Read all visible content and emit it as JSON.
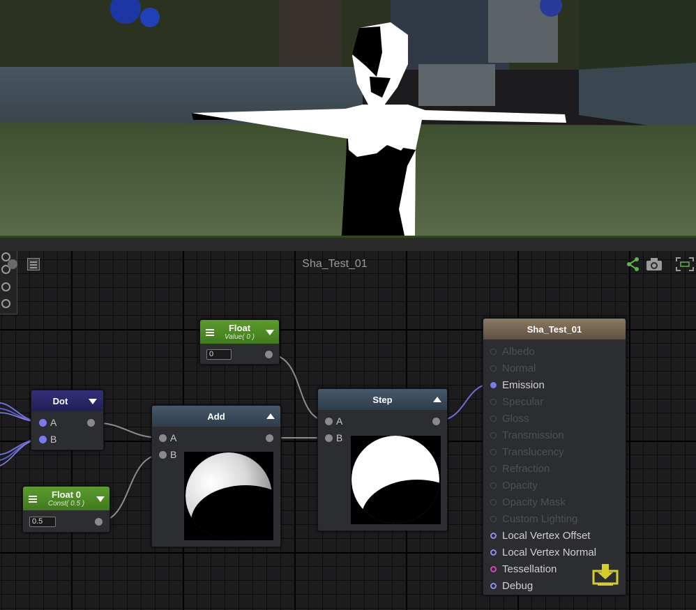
{
  "graph": {
    "title": "Sha_Test_01"
  },
  "nodes": {
    "float_value": {
      "title": "Float",
      "subtitle": "Value( 0 )",
      "value": "0"
    },
    "float_const": {
      "title": "Float 0",
      "subtitle": "Const( 0.5 )",
      "value": "0.5"
    },
    "dot": {
      "title": "Dot",
      "inputs": [
        "A",
        "B"
      ]
    },
    "add": {
      "title": "Add",
      "inputs": [
        "A",
        "B"
      ]
    },
    "step": {
      "title": "Step",
      "inputs": [
        "A",
        "B"
      ]
    },
    "output": {
      "title": "Sha_Test_01",
      "ports": [
        {
          "label": "Albedo",
          "active": false
        },
        {
          "label": "Normal",
          "active": false
        },
        {
          "label": "Emission",
          "active": true,
          "connected": true
        },
        {
          "label": "Specular",
          "active": false
        },
        {
          "label": "Gloss",
          "active": false
        },
        {
          "label": "Transmission",
          "active": false
        },
        {
          "label": "Translucency",
          "active": false
        },
        {
          "label": "Refraction",
          "active": false
        },
        {
          "label": "Opacity",
          "active": false
        },
        {
          "label": "Opacity Mask",
          "active": false
        },
        {
          "label": "Custom Lighting",
          "active": false
        },
        {
          "label": "Local Vertex Offset",
          "active": true
        },
        {
          "label": "Local Vertex Normal",
          "active": true
        },
        {
          "label": "Tessellation",
          "active": true,
          "accent": "#e040c0"
        },
        {
          "label": "Debug",
          "active": true
        }
      ]
    }
  },
  "toolbar_icons": [
    "share-icon",
    "camera-icon",
    "fit-view-icon",
    "graph-icon"
  ],
  "colors": {
    "accent_green": "#5d9c2f",
    "port_blue": "#7b79ee",
    "wire": "#8c8c8c",
    "wire_blue": "#6f6fd8",
    "save_icon": "#d6cf2a"
  }
}
